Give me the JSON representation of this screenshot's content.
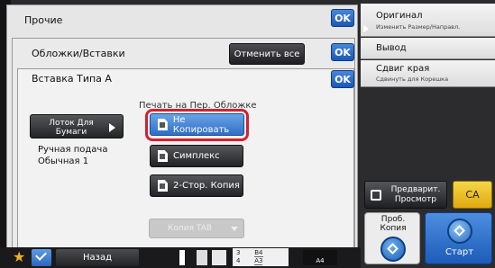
{
  "dialogs": {
    "other": {
      "title": "Прочие",
      "ok": "OK"
    },
    "covers": {
      "title": "Обложки/Вставки",
      "cancel_all": "Отменить все",
      "ok": "OK"
    },
    "insert": {
      "title": "Вставка Типа A",
      "ok": "OK",
      "tray_button": "Лоток Для Бумаги",
      "tray_info_line1": "Ручная подача",
      "tray_info_line2": "Обычная 1",
      "group_label": "Печать на Пер. Обложке",
      "options": [
        "Не Копировать",
        "Симплекс",
        "2-Стор. Копия"
      ],
      "selected_option": "Не Копировать",
      "tab_copy": "Копия TAB"
    }
  },
  "right_panel": {
    "original": {
      "title": "Оригинал",
      "subtitle": "Изменить Размер/Направл."
    },
    "output": {
      "title": "Вывод"
    },
    "edge_shift": {
      "title": "Сдвиг края",
      "subtitle": "Сдвинуть для Корешка"
    },
    "preview": "Предварит. Просмотр",
    "ca": "CA",
    "proof_copy": "Проб. Копия",
    "start": "Старт"
  },
  "bottom_bar": {
    "back": "Назад",
    "trays": [
      {
        "num": "3",
        "size": "B4"
      },
      {
        "num": "4",
        "size": "A3"
      }
    ],
    "paper_size": "A4"
  },
  "colors": {
    "ok_blue": "#1b57b5",
    "highlight_red": "#d52030",
    "selected_option": "#2f6ec7",
    "ca_yellow": "#e0a90f",
    "start_blue": "#1d5bb8"
  }
}
